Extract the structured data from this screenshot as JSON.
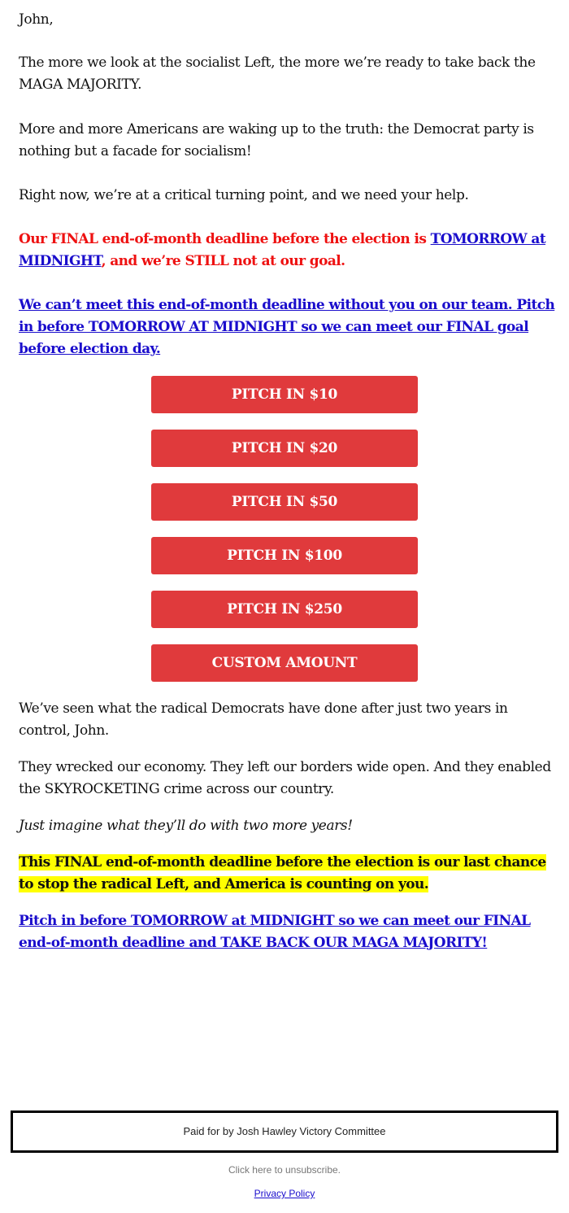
{
  "email": {
    "greeting": "John,",
    "paragraphs": {
      "p1": "The more we look at the socialist Left, the more we’re ready to take back the MAGA MAJORITY.",
      "p2": "More and more Americans are waking up to the truth: the Democrat party is nothing but a facade for socialism!",
      "p3": "Right now, we’re at a critical turning point, and we need your help.",
      "red_lead": "Our FINAL end-of-month deadline before the election is ",
      "red_link": "TOMORROW at MIDNIGHT",
      "red_tail": ", and we’re STILL not at our goal.",
      "link1": "We can’t meet this end-of-month deadline without you on our team. Pitch in before TOMORROW AT MIDNIGHT so we can meet our FINAL goal before election day.",
      "p4": "We’ve seen what the radical Democrats have done after just two years in control, John.",
      "p5": "They wrecked our economy. They left our borders wide open. And they enabled the SKYROCKETING crime across our country.",
      "p6": "Just imagine what they’ll do with two more years!",
      "highlight": "This FINAL end-of-month deadline before the election is our last chance to stop the radical Left, and America is counting on you.",
      "link2": "Pitch in before TOMORROW at MIDNIGHT so we can meet our FINAL end-of-month deadline and TAKE BACK OUR MAGA MAJORITY!"
    },
    "buttons": [
      {
        "label": "PITCH IN $10"
      },
      {
        "label": "PITCH IN $20"
      },
      {
        "label": "PITCH IN $50"
      },
      {
        "label": "PITCH IN $100"
      },
      {
        "label": "PITCH IN $250"
      },
      {
        "label": "CUSTOM AMOUNT"
      }
    ],
    "colors": {
      "button_bg": "#e03a3c",
      "alert_red": "#ee1111",
      "link_blue": "#1a0dcc",
      "highlight_yellow": "#ffff00"
    }
  },
  "footer": {
    "paid_for": "Paid for by Josh Hawley Victory Committee",
    "unsubscribe": "Click here to unsubscribe.",
    "privacy": "Privacy Policy"
  }
}
